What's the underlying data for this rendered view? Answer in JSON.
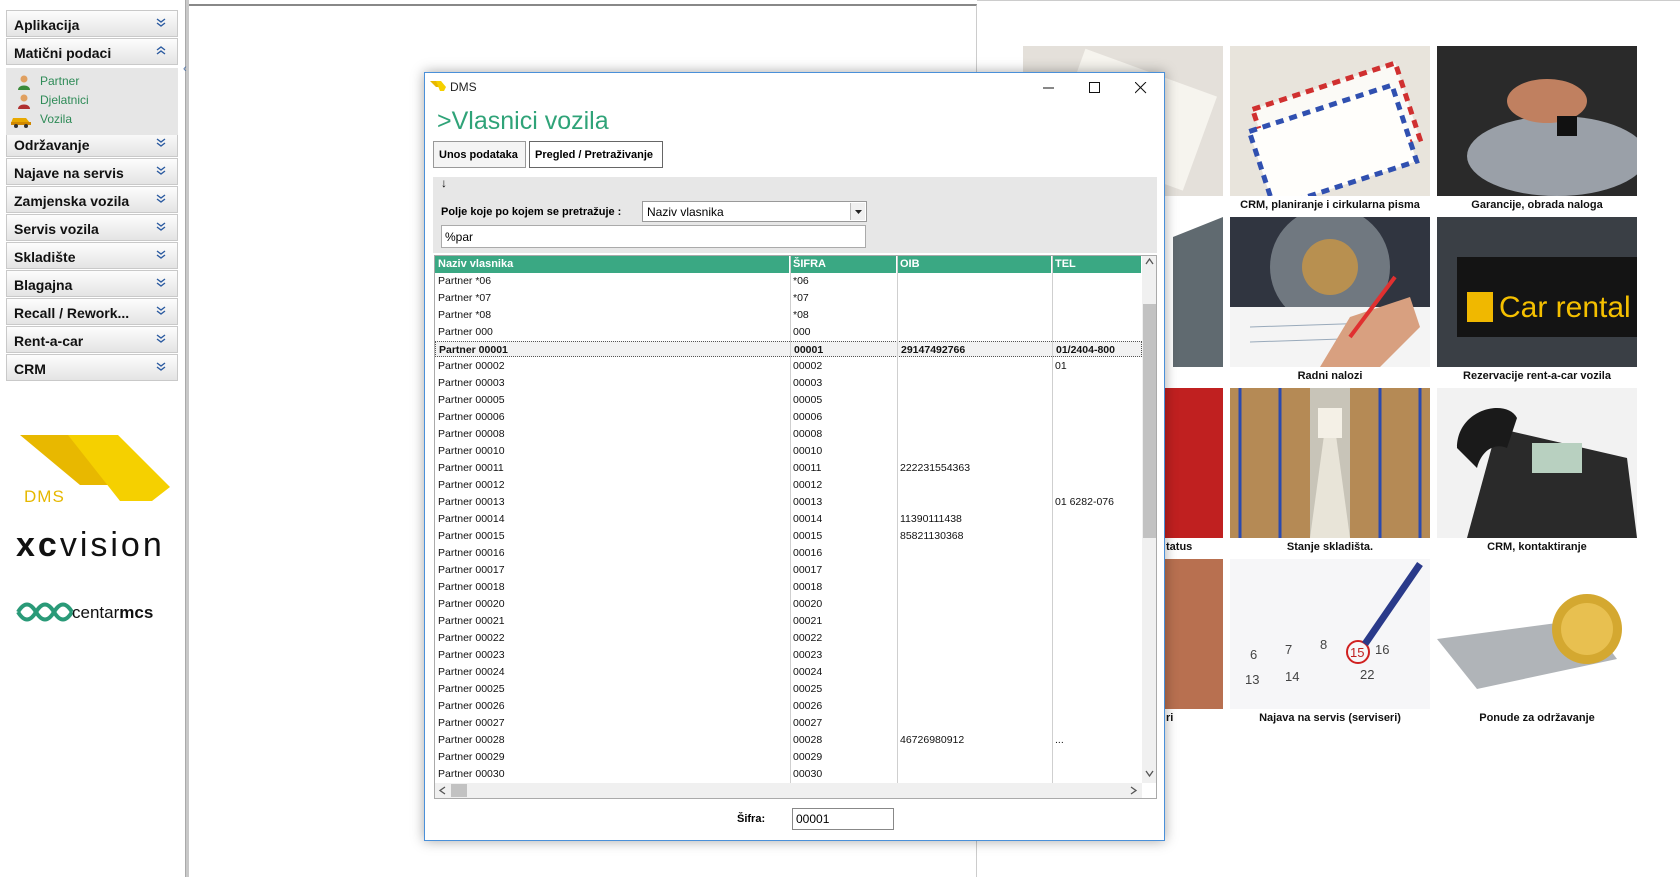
{
  "sidebar": {
    "menu": [
      {
        "label": "Aplikacija",
        "expanded": false
      },
      {
        "label": "Matični podaci",
        "expanded": true
      },
      {
        "label": "Održavanje",
        "expanded": false
      },
      {
        "label": "Najave na servis",
        "expanded": false
      },
      {
        "label": "Zamjenska vozila",
        "expanded": false
      },
      {
        "label": "Servis vozila",
        "expanded": false
      },
      {
        "label": "Skladište",
        "expanded": false
      },
      {
        "label": "Blagajna",
        "expanded": false
      },
      {
        "label": "Recall / Rework...",
        "expanded": false
      },
      {
        "label": "Rent-a-car",
        "expanded": false
      },
      {
        "label": "CRM",
        "expanded": false
      }
    ],
    "submenu": [
      {
        "label": "Partner",
        "icon": "person-icon"
      },
      {
        "label": "Djelatnici",
        "icon": "employee-icon"
      },
      {
        "label": "Vozila",
        "icon": "car-icon"
      }
    ],
    "logo_dms": "DMS",
    "logo_xc": "xc",
    "logo_vision": "vision",
    "logo_centar": "centar",
    "logo_mcs": "mcs"
  },
  "tiles": [
    {
      "label": "CRM, planiranje i cirkularna pisma",
      "theme": "envelopes"
    },
    {
      "label": "Garancije, obrada naloga",
      "theme": "mechanic"
    },
    {
      "label": "Radni nalozi",
      "theme": "brake-disc"
    },
    {
      "label": "Rezervacije rent-a-car vozila",
      "theme": "car-rental"
    },
    {
      "label": "Stanje skladišta.",
      "theme": "warehouse"
    },
    {
      "label": "CRM, kontaktiranje",
      "theme": "phone"
    },
    {
      "label": "Najava na servis (serviseri)",
      "theme": "calendar"
    },
    {
      "label": "Ponude za održavanje",
      "theme": "wrench-coin"
    }
  ],
  "partial_tile_labels": [
    "tatus",
    "ri"
  ],
  "car_rental_sign": "Car rental",
  "calendar_circled_day": "15",
  "dialog": {
    "window_title": "DMS",
    "heading": ">Vlasnici vozila",
    "tabs": [
      "Unos podataka",
      "Pregled / Pretraživanje"
    ],
    "active_tab": 1,
    "sort_arrow": "↓",
    "search_field_label": "Polje koje po kojem se pretražuje :",
    "search_field_value": "Naziv vlasnika",
    "search_text": "%par",
    "columns": [
      "Naziv vlasnika",
      "ŠIFRA",
      "OIB",
      "TEL"
    ],
    "rows": [
      [
        "Partner *06",
        "*06",
        "",
        ""
      ],
      [
        "Partner *07",
        "*07",
        "",
        ""
      ],
      [
        "Partner *08",
        "*08",
        "",
        ""
      ],
      [
        "Partner 000",
        "000",
        "",
        ""
      ],
      [
        "Partner 00001",
        "00001",
        "29147492766",
        "01/2404-800"
      ],
      [
        "Partner 00002",
        "00002",
        "",
        "01"
      ],
      [
        "Partner 00003",
        "00003",
        "",
        ""
      ],
      [
        "Partner 00005",
        "00005",
        "",
        ""
      ],
      [
        "Partner 00006",
        "00006",
        "",
        ""
      ],
      [
        "Partner 00008",
        "00008",
        "",
        ""
      ],
      [
        "Partner 00010",
        "00010",
        "",
        ""
      ],
      [
        "Partner 00011",
        "00011",
        "222231554363",
        ""
      ],
      [
        "Partner 00012",
        "00012",
        "",
        ""
      ],
      [
        "Partner 00013",
        "00013",
        "",
        "01 6282-076"
      ],
      [
        "Partner 00014",
        "00014",
        "11390111438",
        ""
      ],
      [
        "Partner 00015",
        "00015",
        "85821130368",
        ""
      ],
      [
        "Partner 00016",
        "00016",
        "",
        ""
      ],
      [
        "Partner 00017",
        "00017",
        "",
        ""
      ],
      [
        "Partner 00018",
        "00018",
        "",
        ""
      ],
      [
        "Partner 00020",
        "00020",
        "",
        ""
      ],
      [
        "Partner 00021",
        "00021",
        "",
        ""
      ],
      [
        "Partner 00022",
        "00022",
        "",
        ""
      ],
      [
        "Partner 00023",
        "00023",
        "",
        ""
      ],
      [
        "Partner 00024",
        "00024",
        "",
        ""
      ],
      [
        "Partner 00025",
        "00025",
        "",
        ""
      ],
      [
        "Partner 00026",
        "00026",
        "",
        ""
      ],
      [
        "Partner 00027",
        "00027",
        "",
        ""
      ],
      [
        "Partner 00028",
        "00028",
        "46726980912",
        "..."
      ],
      [
        "Partner 00029",
        "00029",
        "",
        ""
      ],
      [
        "Partner 00030",
        "00030",
        "",
        ""
      ]
    ],
    "selected_row": 4,
    "code_label": "Šifra:",
    "code_value": "00001"
  },
  "colors": {
    "accent_green": "#3aa883",
    "heading_green": "#2fa378",
    "link_green": "#2e8b57",
    "logo_yellow": "#f2c500",
    "window_border": "#4a90d9"
  }
}
